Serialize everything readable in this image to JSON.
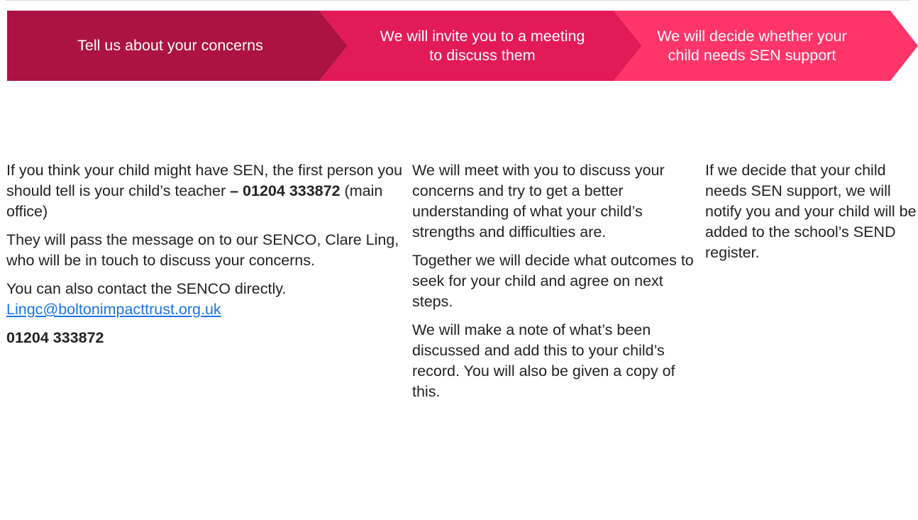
{
  "banner": {
    "colors": {
      "step1": "#ac1344",
      "step2": "#e31a58",
      "step3": "#ff3468"
    },
    "step1": {
      "line1": "Tell us about your concerns"
    },
    "step2": {
      "line1": "We will invite you to a meeting",
      "line2": "to discuss them"
    },
    "step3": {
      "line1": "We will decide whether your",
      "line2": "child needs SEN support"
    }
  },
  "col1": {
    "p1_text": "If you think your child might have SEN, the first person you should tell is your child’s teacher",
    "p1_phone": "– 01204 333872",
    "p1_suffix": "(main office)",
    "p2": "They will pass the message on to our SENCO, Clare Ling, who will be in touch to discuss your concerns.",
    "p3_text": "You can also contact the SENCO directly.",
    "email": "Lingc@boltonimpacttrust.org.uk",
    "phone": "01204 333872"
  },
  "col2": {
    "p1": "We will meet with you to discuss your concerns and try to get a better understanding of what your child’s strengths and difficulties are.",
    "p2": "Together we will decide what outcomes to seek for your child and agree on next steps.",
    "p3": "We will make a note of what’s been discussed and add this to your child’s record. You will also be given a copy of this."
  },
  "col3": {
    "p1": "If we decide that your child needs SEN support, we will notify you and your child will be added to the school’s SEND register."
  }
}
